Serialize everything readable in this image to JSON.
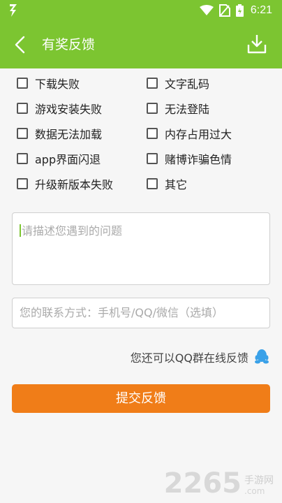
{
  "status_bar": {
    "time": "6:21",
    "app_icon": "lightning-app-icon",
    "icons": [
      "wifi-icon",
      "no-sim-icon",
      "battery-icon"
    ]
  },
  "header": {
    "title": "有奖反馈",
    "back_icon": "back-arrow-icon",
    "download_icon": "download-icon"
  },
  "options": [
    [
      "下载失败",
      "文字乱码"
    ],
    [
      "游戏安装失败",
      "无法登陆"
    ],
    [
      "数据无法加载",
      "内存占用过大"
    ],
    [
      "app界面闪退",
      "赌博诈骗色情"
    ],
    [
      "升级新版本失败",
      "其它"
    ]
  ],
  "description": {
    "placeholder": "请描述您遇到的问题"
  },
  "contact": {
    "placeholder": "您的联系方式：手机号/QQ/微信（选填）"
  },
  "qq": {
    "text": "您还可以QQ群在线反馈",
    "icon": "qq-penguin-icon"
  },
  "submit": {
    "label": "提交反馈"
  },
  "watermark": {
    "number": "2265",
    "cn": "手游网",
    "en": ".com"
  },
  "colors": {
    "header": "#7cc531",
    "submit": "#f07d18",
    "qq_icon": "#3aa1e8"
  }
}
